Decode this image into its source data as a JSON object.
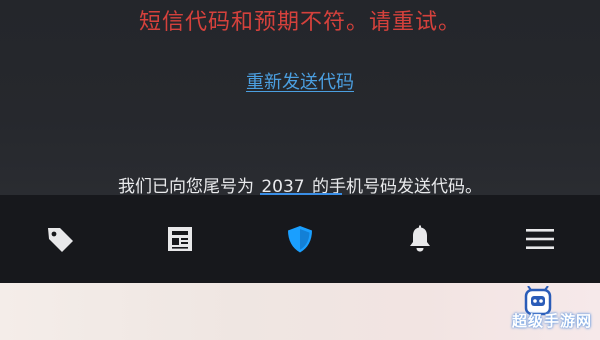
{
  "messages": {
    "error": "短信代码和预期不符。请重试。",
    "resend_link": "重新发送代码",
    "sent_prefix": "我们已向您尾号为 ",
    "sent_digits": "2037",
    "sent_suffix": " 的手机号码发送代码。"
  },
  "tabbar": {
    "items": [
      {
        "icon": "tag-icon",
        "active": false
      },
      {
        "icon": "news-icon",
        "active": false
      },
      {
        "icon": "shield-icon",
        "active": true
      },
      {
        "icon": "bell-icon",
        "active": false
      },
      {
        "icon": "menu-icon",
        "active": false
      }
    ]
  },
  "watermark": {
    "text": "超级手游网"
  },
  "colors": {
    "error": "#d5413c",
    "link": "#4b9fe0",
    "active_icon": "#1a9fff",
    "inactive_icon": "#e8e8ea",
    "tabbar_bg": "#17181c",
    "content_bg": "#26282d"
  }
}
